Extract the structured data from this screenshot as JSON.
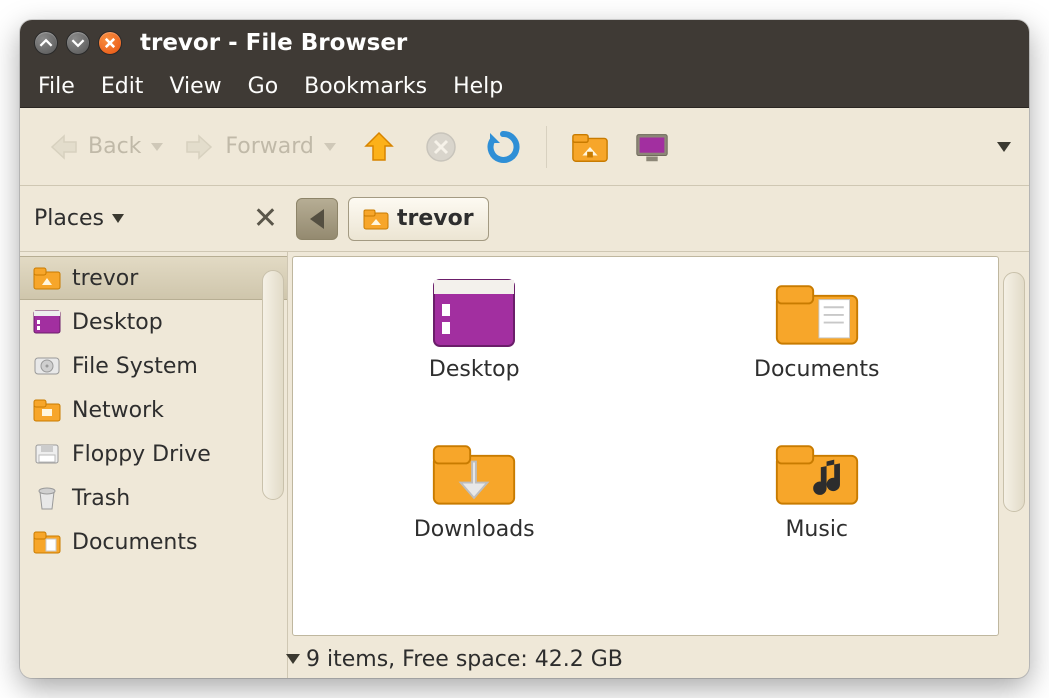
{
  "window": {
    "title": "trevor - File Browser"
  },
  "menubar": [
    "File",
    "Edit",
    "View",
    "Go",
    "Bookmarks",
    "Help"
  ],
  "toolbar": {
    "back_label": "Back",
    "forward_label": "Forward"
  },
  "places_header": "Places",
  "path": {
    "segment": "trevor"
  },
  "sidebar": {
    "items": [
      {
        "label": "trevor",
        "icon": "home-folder",
        "selected": true
      },
      {
        "label": "Desktop",
        "icon": "desktop"
      },
      {
        "label": "File System",
        "icon": "disk"
      },
      {
        "label": "Network",
        "icon": "network"
      },
      {
        "label": "Floppy Drive",
        "icon": "floppy"
      },
      {
        "label": "Trash",
        "icon": "trash"
      },
      {
        "label": "Documents",
        "icon": "documents"
      }
    ]
  },
  "content": {
    "items": [
      {
        "label": "Desktop",
        "icon": "desktop-big"
      },
      {
        "label": "Documents",
        "icon": "documents-big"
      },
      {
        "label": "Downloads",
        "icon": "downloads-big"
      },
      {
        "label": "Music",
        "icon": "music-big"
      }
    ]
  },
  "statusbar": "9 items, Free space: 42.2 GB"
}
